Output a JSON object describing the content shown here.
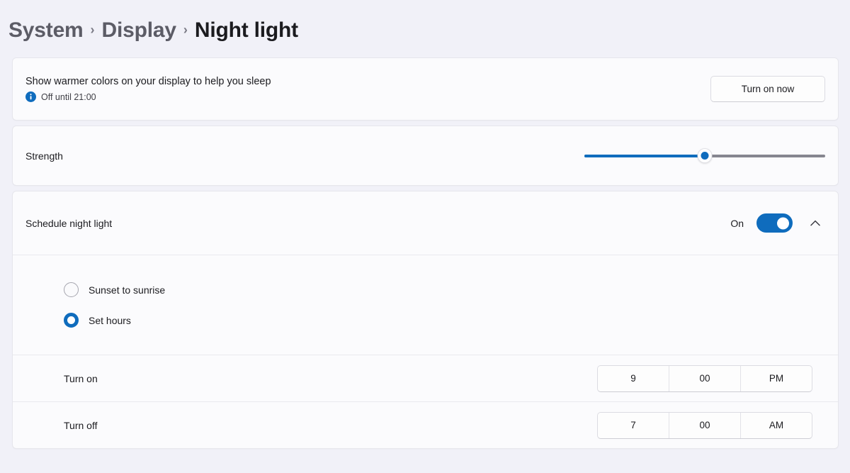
{
  "breadcrumb": {
    "items": [
      "System",
      "Display"
    ],
    "separator": "›",
    "current": "Night light"
  },
  "summary_card": {
    "title": "Show warmer colors on your display to help you sleep",
    "status_icon": "info-icon",
    "status_text": "Off until 21:00",
    "button_label": "Turn on now"
  },
  "strength_card": {
    "label": "Strength",
    "value_percent": 50
  },
  "schedule_card": {
    "label": "Schedule night light",
    "toggle_state": "On",
    "toggle_on": true,
    "expander_icon": "chevron-up-icon",
    "options": [
      {
        "label": "Sunset to sunrise",
        "selected": false
      },
      {
        "label": "Set hours",
        "selected": true
      }
    ],
    "times": [
      {
        "label": "Turn on",
        "hour": "9",
        "minute": "00",
        "meridiem": "PM"
      },
      {
        "label": "Turn off",
        "hour": "7",
        "minute": "00",
        "meridiem": "AM"
      }
    ]
  },
  "colors": {
    "accent": "#0f6cbd",
    "page_background": "#f1f1f8",
    "card_background": "#fbfbfd",
    "text_primary": "#1b1b1f",
    "text_secondary": "#5c5c66",
    "track_inactive": "#868690"
  }
}
